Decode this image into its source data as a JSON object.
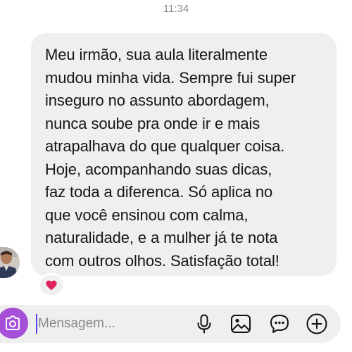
{
  "header": {
    "time": "11:34"
  },
  "message": {
    "lines": [
      "Meu irmão, sua aula literalmente",
      "mudou minha vida. Sempre fui super",
      "inseguro no assunto abordagem,",
      "nunca soube pra onde ir e mais",
      "atrapalhava do que qualquer coisa.",
      "Hoje, acompanhando suas dicas,",
      "faz toda a diferenca. Só aplica no",
      "que você ensinou com calma,",
      "naturalidade, e a mulher já te nota",
      "com outros olhos. Satisfação total!"
    ],
    "reaction": "heart"
  },
  "composer": {
    "placeholder": "Mensagem...",
    "value": "",
    "icons": [
      "camera-icon",
      "microphone-icon",
      "gallery-icon",
      "sticker-icon",
      "plus-icon"
    ]
  },
  "colors": {
    "camera_button": "#a64fd8",
    "bubble": "#efeff0",
    "reaction_heart": "#e0245e"
  }
}
